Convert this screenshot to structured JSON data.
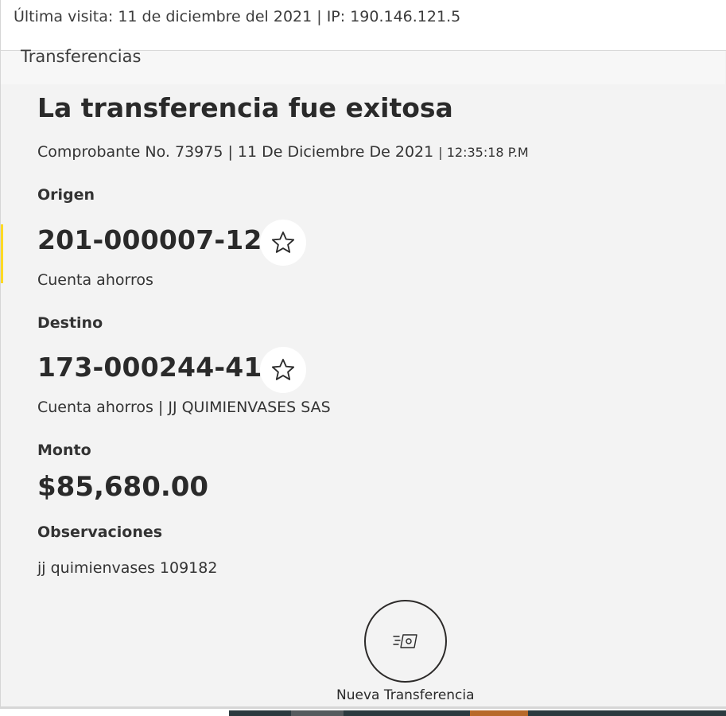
{
  "header": {
    "last_visit": "Última visita: 11 de diciembre del 2021 | IP: 190.146.121.5"
  },
  "section": {
    "title": "Transferencias"
  },
  "result": {
    "title": "La transferencia fue exitosa",
    "receipt_prefix": "Comprobante No. 73975 | 11 De Diciembre De 2021 ",
    "receipt_time": "| 12:35:18 P.M"
  },
  "origin": {
    "label": "Origen",
    "account": "201-000007-12",
    "type": "Cuenta ahorros",
    "favorite_icon": "star-outline-icon"
  },
  "destination": {
    "label": "Destino",
    "account": "173-000244-41",
    "type": "Cuenta ahorros | JJ QUIMIENVASES SAS",
    "favorite_icon": "star-outline-icon"
  },
  "amount": {
    "label": "Monto",
    "value": "$85,680.00"
  },
  "notes": {
    "label": "Observaciones",
    "value": "jj quimienvases 109182"
  },
  "actions": {
    "new_transfer_label": "Nueva Transferencia",
    "new_transfer_icon": "money-transfer-icon"
  },
  "colors": {
    "accent_yellow": "#fdda24",
    "content_bg": "#f3f3f3",
    "text_dark": "#2a2a2a"
  }
}
